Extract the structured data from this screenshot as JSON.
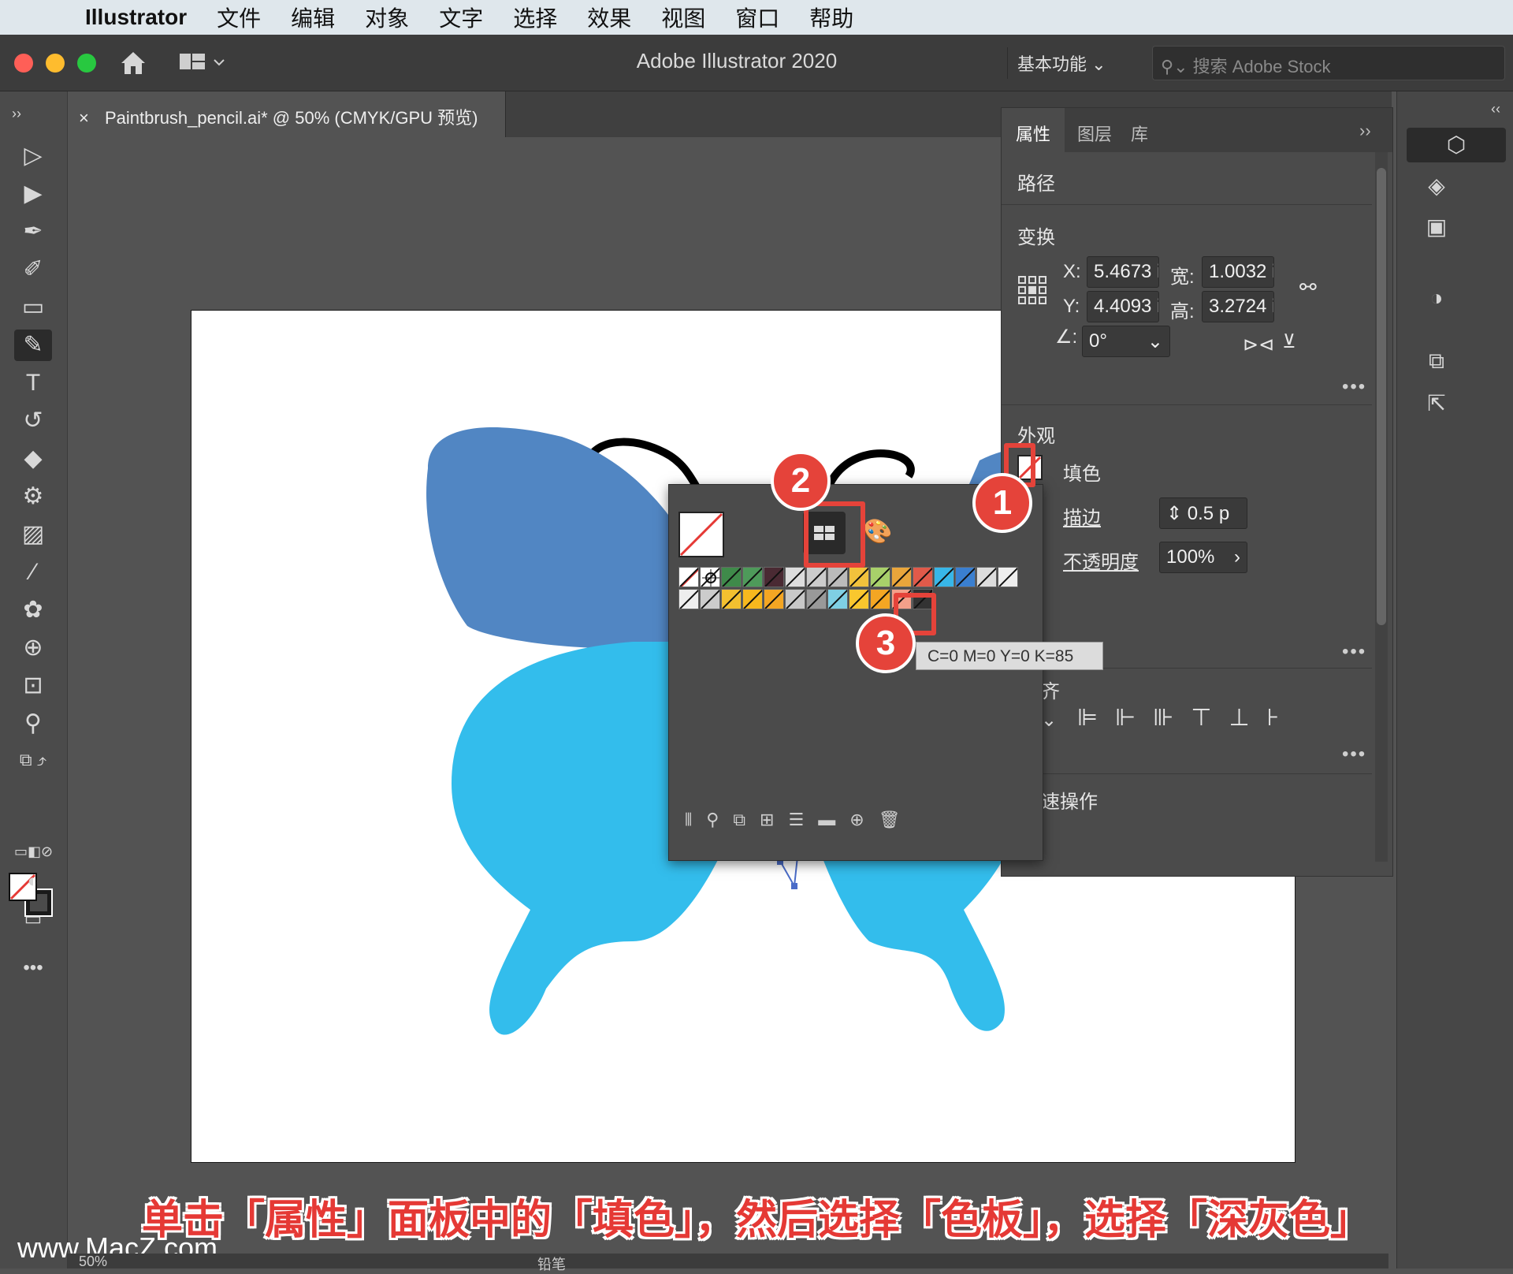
{
  "menubar": {
    "app": "Illustrator",
    "items": [
      "文件",
      "编辑",
      "对象",
      "文字",
      "选择",
      "效果",
      "视图",
      "窗口",
      "帮助"
    ]
  },
  "titlebar": {
    "title": "Adobe Illustrator 2020",
    "workspace": "基本功能",
    "stock_placeholder": "搜索 Adobe Stock"
  },
  "document_tab": {
    "close": "×",
    "title": "Paintbrush_pencil.ai* @ 50% (CMYK/GPU 预览)"
  },
  "properties": {
    "tabs": [
      "属性",
      "图层",
      "库"
    ],
    "object_type": "路径",
    "transform": {
      "heading": "变换",
      "x_label": "X:",
      "x": "5.4673 i",
      "y_label": "Y:",
      "y": "4.4093 i",
      "w_label": "宽:",
      "w": "1.0032 ir",
      "h_label": "高:",
      "h": "3.2724 ir",
      "angle": "0°"
    },
    "appearance": {
      "heading": "外观",
      "fill_label": "填色",
      "stroke_label": "描边",
      "stroke_value": "0.5 p",
      "opacity_label": "不透明度",
      "opacity_value": "100%"
    },
    "align_heading_partial": "齐",
    "quick_actions_partial": "速操作"
  },
  "swatches_popup": {
    "row1": [
      "none",
      "registration",
      "#3f8a4a",
      "#4e9a5a",
      "#4a2a33",
      "#dddddd",
      "#cccccc",
      "#bbbbbb",
      "#f2c23c",
      "#a8d06a",
      "#e9a53b",
      "#e05a4a",
      "#38b6e8",
      "#3a7fd0",
      "#dddddd",
      "#eeeeee"
    ],
    "row2": [
      "#eeeeee",
      "#cccccc",
      "#f3c030",
      "#f7b81e",
      "#f4a623",
      "#c8c8c8",
      "#999999",
      "#7fcfe4",
      "#f9c72e",
      "#f4a623",
      "#f3a08a",
      "#333333"
    ],
    "tooltip": "C=0 M=0 Y=0 K=85"
  },
  "callouts": [
    "1",
    "2",
    "3"
  ],
  "caption": "单击「属性」面板中的「填色」，然后选择「色板」，选择「深灰色」",
  "watermark": "www.MacZ.com",
  "statusbar": {
    "zoom": "50%",
    "tool": "铅笔"
  },
  "colors": {
    "accent_red": "#e5433a",
    "butterfly_upper": "#5186c3",
    "butterfly_lower": "#33bdec"
  }
}
